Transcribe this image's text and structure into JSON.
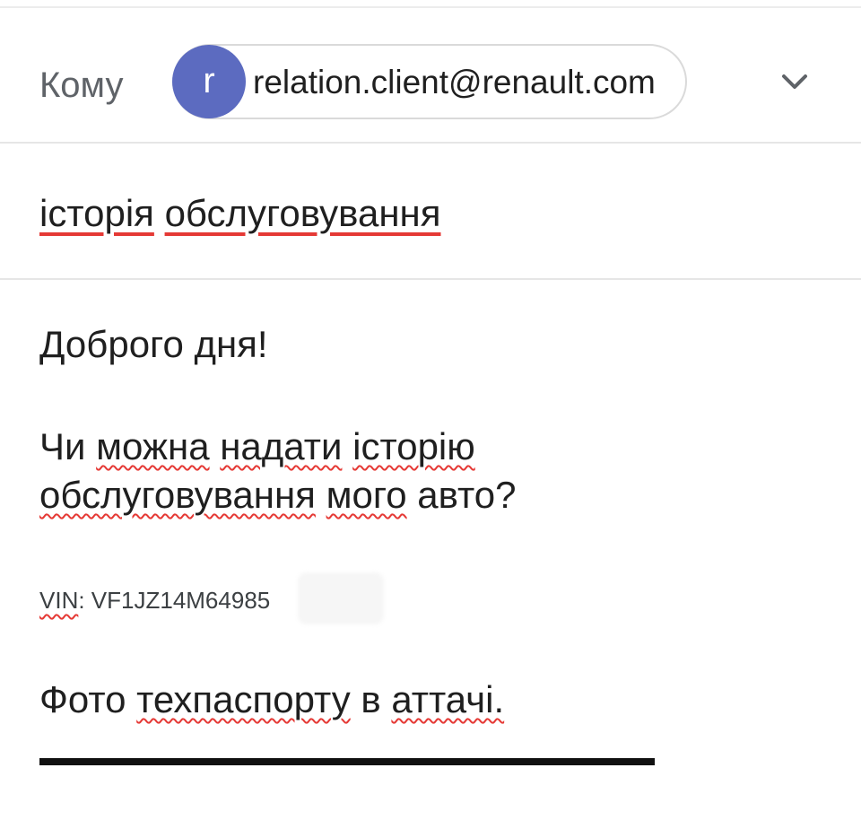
{
  "compose": {
    "to_label": "Кому",
    "recipient": {
      "avatar_letter": "r",
      "avatar_color": "#5c6bc0",
      "email": "relation.client@renault.com"
    },
    "expand_icon": "chevron-down-icon",
    "subject_words": [
      "історія",
      "обслуговування"
    ],
    "body": {
      "greeting": "Доброго дня!",
      "line1_words": [
        "Чи",
        "можна",
        "надати",
        "історію"
      ],
      "line2_words": [
        "обслуговування",
        "мого",
        "авто?"
      ],
      "vin_label": "VIN",
      "vin_value": ": VF1JZ14M64985",
      "attach_words": [
        "Фото",
        "техпаспорту",
        "в",
        "аттачі."
      ]
    }
  },
  "colors": {
    "spellcheck": "#e53935",
    "divider": "#e6e6e6"
  }
}
